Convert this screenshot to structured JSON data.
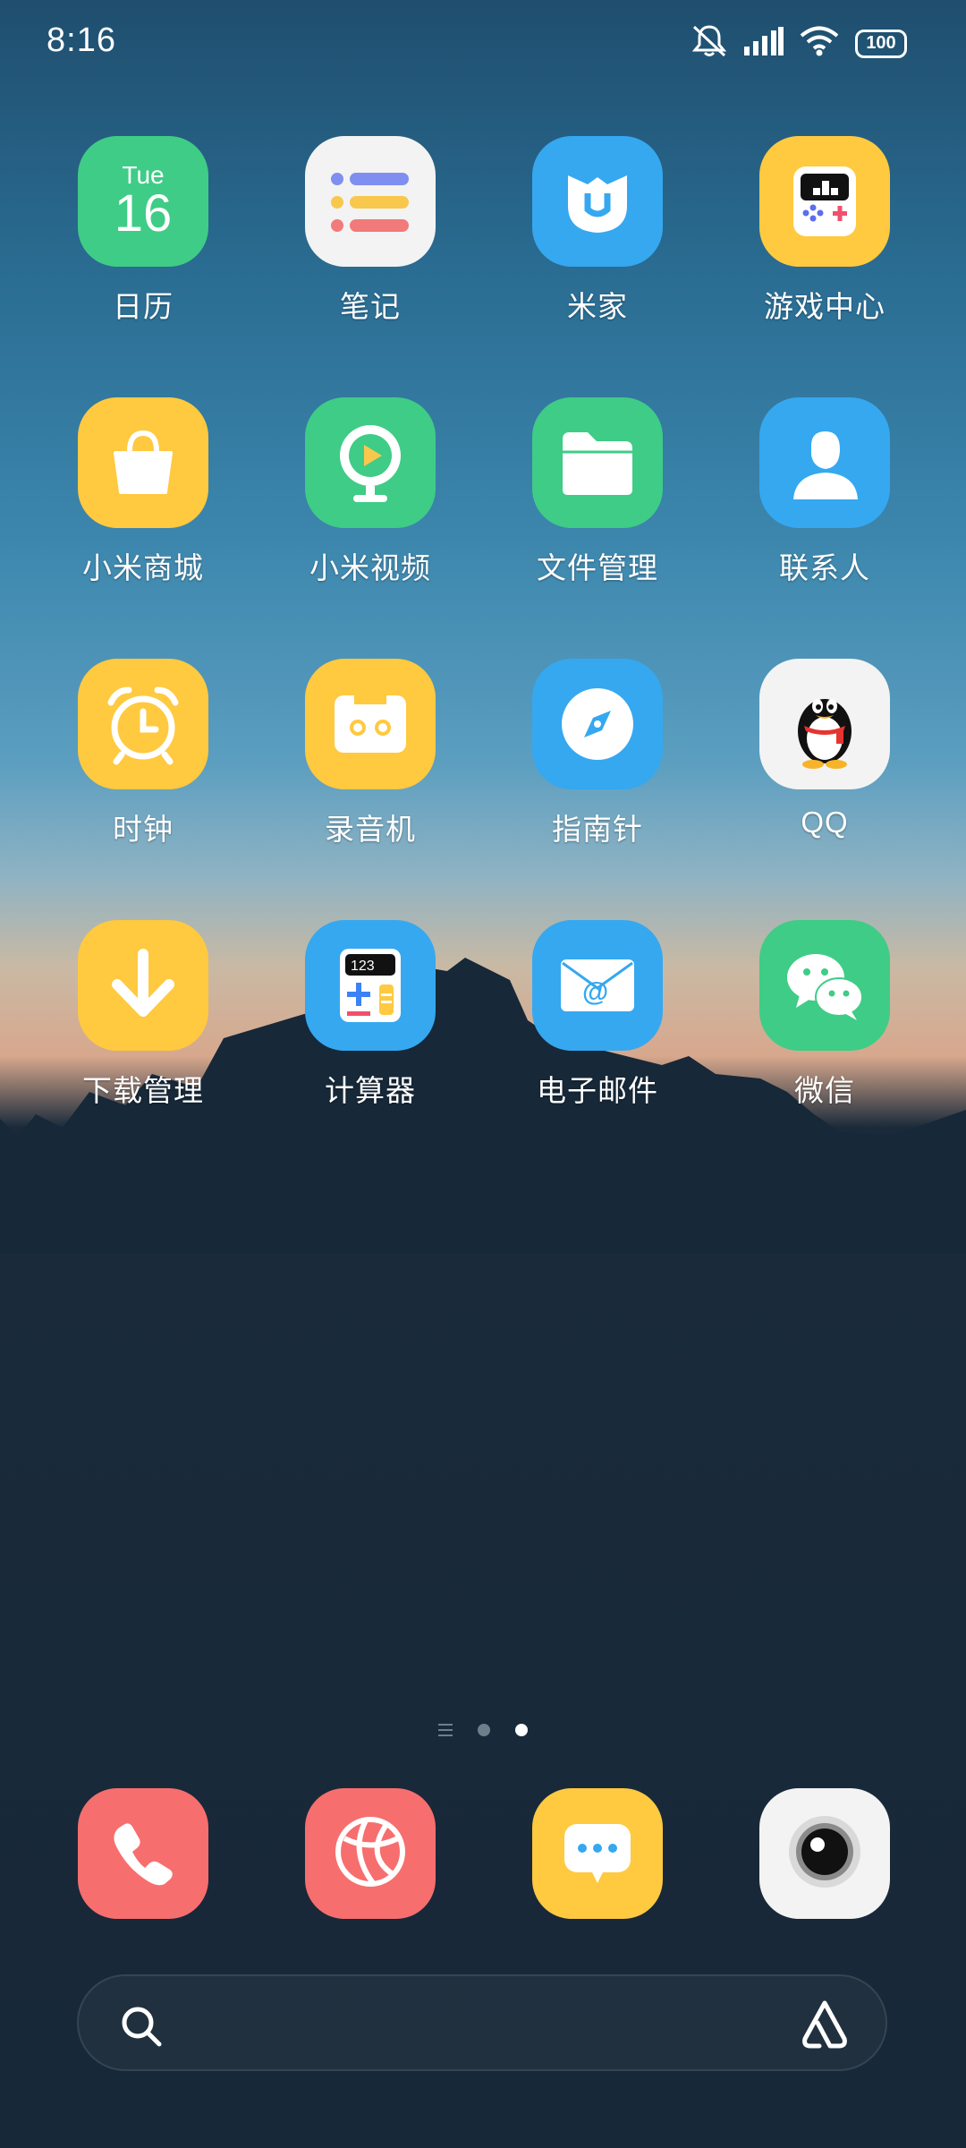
{
  "status_bar": {
    "time": "8:16",
    "battery": "100",
    "icons": [
      "mute-icon",
      "signal-icon",
      "wifi-icon",
      "battery-icon"
    ]
  },
  "apps": [
    {
      "label": "日历",
      "icon": "calendar-icon",
      "day": "Tue",
      "date": "16"
    },
    {
      "label": "笔记",
      "icon": "notes-icon"
    },
    {
      "label": "米家",
      "icon": "mi-home-icon"
    },
    {
      "label": "游戏中心",
      "icon": "game-center-icon"
    },
    {
      "label": "小米商城",
      "icon": "mi-store-icon"
    },
    {
      "label": "小米视频",
      "icon": "mi-video-icon"
    },
    {
      "label": "文件管理",
      "icon": "file-manager-icon"
    },
    {
      "label": "联系人",
      "icon": "contacts-icon"
    },
    {
      "label": "时钟",
      "icon": "clock-icon"
    },
    {
      "label": "录音机",
      "icon": "recorder-icon"
    },
    {
      "label": "指南针",
      "icon": "compass-icon"
    },
    {
      "label": "QQ",
      "icon": "qq-icon"
    },
    {
      "label": "下载管理",
      "icon": "download-icon"
    },
    {
      "label": "计算器",
      "icon": "calculator-icon",
      "display": "123"
    },
    {
      "label": "电子邮件",
      "icon": "email-icon"
    },
    {
      "label": "微信",
      "icon": "wechat-icon"
    }
  ],
  "pager": {
    "pages": 2,
    "active": 2
  },
  "dock": [
    {
      "icon": "phone-icon"
    },
    {
      "icon": "browser-icon"
    },
    {
      "icon": "messages-icon"
    },
    {
      "icon": "camera-icon"
    }
  ],
  "search_bar": {
    "icons": [
      "search-icon",
      "assistant-icon"
    ]
  },
  "colors": {
    "green": "#3fcc86",
    "blue": "#35a8f0",
    "yellow": "#ffc940",
    "red": "#f76e6e"
  }
}
